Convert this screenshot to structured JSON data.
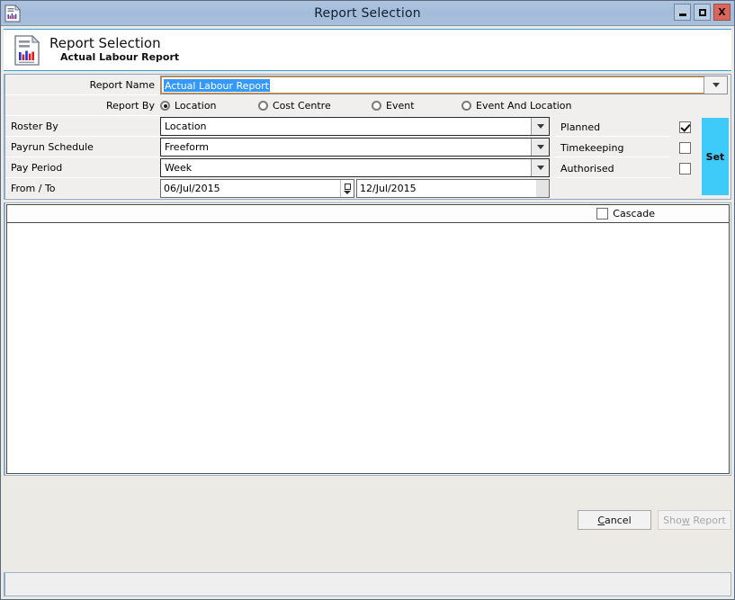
{
  "window": {
    "title": "Report Selection",
    "icon": "report-document-icon",
    "minimize_label": "Minimize",
    "maximize_label": "Maximize",
    "close_label": "X"
  },
  "header": {
    "icon": "report-document-icon",
    "title": "Report Selection",
    "subtitle": "Actual Labour Report"
  },
  "form": {
    "report_name": {
      "label": "Report Name",
      "value": "Actual Labour Report",
      "selected": true
    },
    "report_by": {
      "label": "Report By",
      "options": [
        {
          "label": "Location",
          "checked": true
        },
        {
          "label": "Cost Centre",
          "checked": false
        },
        {
          "label": "Event",
          "checked": false
        },
        {
          "label": "Event And Location",
          "checked": false
        }
      ]
    },
    "roster_by": {
      "label": "Roster By",
      "value": "Location"
    },
    "payrun_schedule": {
      "label": "Payrun Schedule",
      "value": "Freeform"
    },
    "pay_period": {
      "label": "Pay Period",
      "value": "Week"
    },
    "from_to": {
      "label": "From / To",
      "from": "06/Jul/2015",
      "to": "12/Jul/2015"
    }
  },
  "options": {
    "rows": [
      {
        "label": "Planned",
        "checked": true
      },
      {
        "label": "Timekeeping",
        "checked": false
      },
      {
        "label": "Authorised",
        "checked": false
      }
    ],
    "set_button": "Set"
  },
  "list_panel": {
    "cascade": {
      "label": "Cascade",
      "checked": false
    },
    "items": []
  },
  "footer": {
    "cancel": "Cancel",
    "cancel_accel": "C",
    "show_report": "Show Report",
    "show_report_accel": "w",
    "show_report_enabled": false
  },
  "statusbar": {
    "text": ""
  },
  "colors": {
    "titlebar": "#a8c0dc",
    "accent_cyan": "#3fcbfa",
    "selection_blue": "#3399ff",
    "close_red": "#d9675c",
    "header_rule": "#3a9fd6"
  }
}
